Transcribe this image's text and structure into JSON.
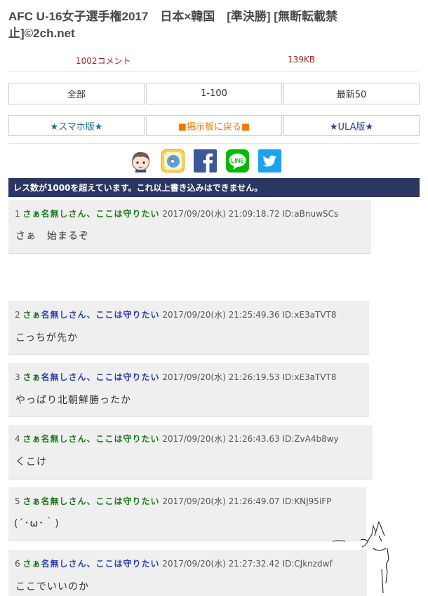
{
  "thread": {
    "title": "AFC U-16女子選手権2017　日本×韓国　[準決勝] [無断転載禁止]©2ch.net",
    "comments": "1002コメント",
    "size": "139KB"
  },
  "nav": {
    "all": "全部",
    "range": "1-100",
    "latest": "最新50",
    "smartphone": "★スマホ版★",
    "back": "■掲示板に戻る■",
    "ula": "★ULA版★"
  },
  "share": {
    "icons": [
      "character-icon",
      "app-icon",
      "facebook-icon",
      "line-icon",
      "twitter-icon"
    ],
    "line_text": "LINE"
  },
  "notice": "レス数が1000を超えています。これ以上書き込みはできません。",
  "posts": [
    {
      "num": "1",
      "name_a": "さぁ名無しさん、",
      "name_b": "ここは守りたい",
      "date": "2017/09/20(水) 21:09:18.72 ID:aBnuwSCs",
      "body": "さぁ　始まるぞ"
    },
    {
      "num": "2",
      "name_a": "さぁ",
      "name_mid": "名無しさん、ここは守りたい",
      "date": "2017/09/20(水) 21:25:49.36 ID:xE3aTVT8",
      "body": "こっちが先か"
    },
    {
      "num": "3",
      "name_a": "さぁ",
      "name_mid": "名無しさん、ここは守りたい",
      "date": "2017/09/20(水) 21:26:19.53 ID:xE3aTVT8",
      "body": "やっぱり北朝鮮勝ったか"
    },
    {
      "num": "4",
      "name_a": "さぁ名無しさん、",
      "name_b": "ここは守りたい",
      "date": "2017/09/20(水) 21:26:43.63 ID:ZvA4b8wy",
      "body": "くこけ"
    },
    {
      "num": "5",
      "name_a": "さぁ名無しさん、",
      "name_b": "ここは守りたい",
      "date": "2017/09/20(水) 21:26:49.07 ID:KNJ95iFP",
      "body": "(´･ω･｀)"
    },
    {
      "num": "6",
      "name_a": "さぁ",
      "name_mid": "名無しさん、ここは守りたい",
      "date": "2017/09/20(水) 21:27:32.42 ID:CJknzdwf",
      "body": "ここでいいのか"
    }
  ],
  "colors": {
    "notice_bg": "#2b3763",
    "name_green": "#1b7a1b",
    "name_blue": "#2b3fb5",
    "meta_red": "#a22222"
  }
}
